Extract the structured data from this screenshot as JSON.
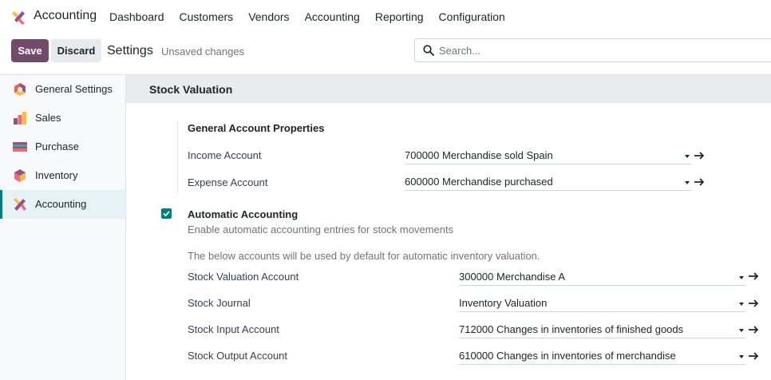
{
  "app": {
    "name": "Accounting",
    "logo_icon": "accounting-app-icon",
    "menu": [
      "Dashboard",
      "Customers",
      "Vendors",
      "Accounting",
      "Reporting",
      "Configuration"
    ]
  },
  "control_panel": {
    "save_label": "Save",
    "discard_label": "Discard",
    "title": "Settings",
    "status": "Unsaved changes",
    "search_placeholder": "Search..."
  },
  "sidebar": {
    "items": [
      {
        "label": "General Settings",
        "icon": "general-settings-icon",
        "active": false
      },
      {
        "label": "Sales",
        "icon": "sales-icon",
        "active": false
      },
      {
        "label": "Purchase",
        "icon": "purchase-icon",
        "active": false
      },
      {
        "label": "Inventory",
        "icon": "inventory-icon",
        "active": false
      },
      {
        "label": "Accounting",
        "icon": "accounting-icon",
        "active": true
      }
    ]
  },
  "section": {
    "title": "Stock Valuation",
    "general_account": {
      "title": "General Account Properties",
      "rows": [
        {
          "label": "Income Account",
          "value": "700000 Merchandise sold Spain"
        },
        {
          "label": "Expense Account",
          "value": "600000 Merchandise purchased"
        }
      ]
    },
    "automatic": {
      "checked": true,
      "title": "Automatic Accounting",
      "description": "Enable automatic accounting entries for stock movements",
      "note": "The below accounts will be used by default for automatic inventory valuation.",
      "rows": [
        {
          "label": "Stock Valuation Account",
          "value": "300000 Merchandise A"
        },
        {
          "label": "Stock Journal",
          "value": "Inventory Valuation"
        },
        {
          "label": "Stock Input Account",
          "value": "712000 Changes in inventories of finished goods"
        },
        {
          "label": "Stock Output Account",
          "value": "610000 Changes in inventories of merchandise"
        }
      ]
    }
  },
  "colors": {
    "primary": "#714b67",
    "accent": "#017e84",
    "active_bg": "#e6f2f3"
  }
}
